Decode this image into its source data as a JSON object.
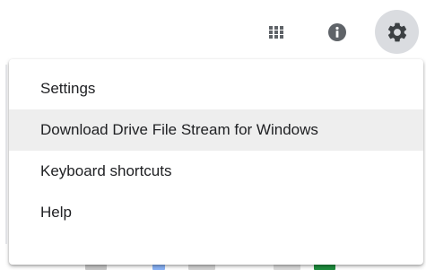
{
  "toolbar": {
    "apps_icon": "apps-grid-icon",
    "info_icon": "info-icon",
    "settings_icon": "gear-icon"
  },
  "settings_menu": {
    "items": [
      {
        "label": "Settings"
      },
      {
        "label": "Download Drive File Stream for Windows",
        "highlighted": true
      },
      {
        "label": "Keyboard shortcuts"
      },
      {
        "label": "Help"
      }
    ]
  },
  "colors": {
    "icon": "#5f6368",
    "active_button_bg": "#dadce0",
    "highlight_bg": "#eeeeee",
    "text": "#202124"
  }
}
